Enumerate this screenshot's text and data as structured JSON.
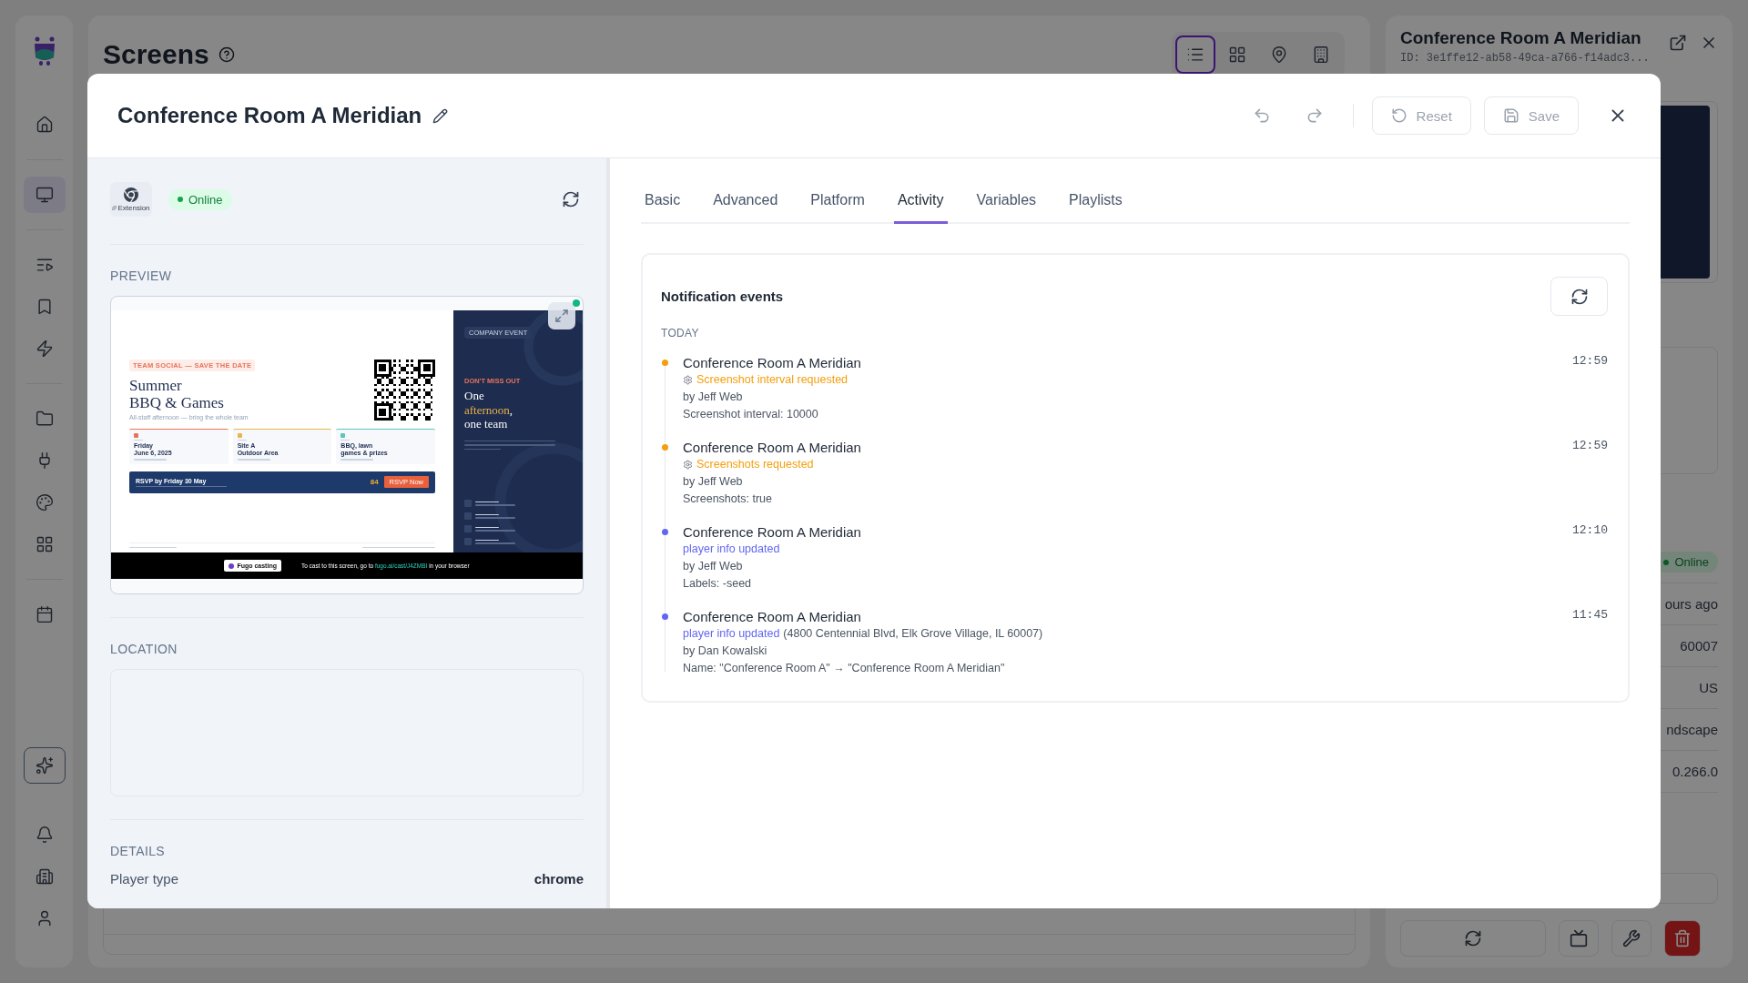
{
  "sidebar": {
    "groups": [
      {
        "items": [
          {
            "kind": "home",
            "selected": false
          }
        ]
      },
      {
        "items": [
          {
            "kind": "screens",
            "selected": true
          }
        ]
      },
      {
        "items": [
          {
            "kind": "playlists",
            "selected": false
          },
          {
            "kind": "bookmarks",
            "selected": false
          },
          {
            "kind": "automations",
            "selected": false
          }
        ]
      },
      {
        "items": [
          {
            "kind": "files",
            "selected": false
          },
          {
            "kind": "integrations",
            "selected": false
          },
          {
            "kind": "themes",
            "selected": false
          },
          {
            "kind": "apps",
            "selected": false
          }
        ]
      },
      {
        "items": [
          {
            "kind": "schedule",
            "selected": false
          }
        ]
      }
    ],
    "bottom_groups": [
      {
        "items": [
          {
            "kind": "assistant",
            "selected": false
          }
        ]
      },
      {
        "items": [
          {
            "kind": "notifications",
            "selected": false
          },
          {
            "kind": "organization",
            "selected": false
          },
          {
            "kind": "account",
            "selected": false
          }
        ]
      }
    ]
  },
  "page": {
    "title": "Screens",
    "views": [
      {
        "kind": "list",
        "selected": true
      },
      {
        "kind": "grid",
        "selected": false
      },
      {
        "kind": "map",
        "selected": false
      },
      {
        "kind": "building",
        "selected": false
      }
    ]
  },
  "detail_panel": {
    "title": "Conference Room A Meridian",
    "id": "ID: 3e1ffe12-ab58-49ca-a766-f14adc3...",
    "status": "Online",
    "rows": [
      {
        "value": "ours ago"
      },
      {
        "value": "60007"
      },
      {
        "value": "US"
      },
      {
        "value": "ndscape"
      },
      {
        "value": "0.266.0"
      }
    ]
  },
  "dialog": {
    "title": "Conference Room A Meridian",
    "history": [
      {
        "kind": "undo",
        "disabled": true
      },
      {
        "kind": "redo",
        "disabled": true
      }
    ],
    "actions": [
      {
        "kind": "reset",
        "label": "Reset",
        "disabled": true
      },
      {
        "kind": "save",
        "label": "Save",
        "disabled": true
      }
    ],
    "player": {
      "badge": "Extension",
      "status": "Online",
      "online": true
    },
    "preview": {
      "label": "PREVIEW",
      "live": true,
      "screenshot": {
        "tag": "TEAM SOCIAL — SAVE THE DATE",
        "title_lines": [
          "Summer",
          "BBQ & Games"
        ],
        "subtitle": "All-staff afternoon — bring the whole team",
        "cards": [
          {
            "value_lines": [
              "Friday",
              "June 6, 2025"
            ],
            "color": "#e8735a"
          },
          {
            "value_lines": [
              "Site A",
              "Outdoor Area"
            ],
            "color": "#e8b64a"
          },
          {
            "value_lines": [
              "BBQ, lawn",
              "games & prizes"
            ],
            "color": "#5ac8b8"
          }
        ],
        "rsvp": {
          "title": "RSVP by Friday 30 May",
          "count": "84",
          "button": "RSVP Now"
        },
        "side_tag": "COMPANY EVENT",
        "kicker": "DON'T MISS OUT",
        "headline": [
          [
            {
              "text": "One",
              "accent": false
            }
          ],
          [
            {
              "text": "afternoon",
              "accent": true
            },
            {
              "text": ",",
              "accent": false
            }
          ],
          [
            {
              "text": "one team",
              "accent": false
            }
          ]
        ],
        "cast": {
          "chip": "Fugo casting",
          "before": "To cast to this screen, go to",
          "link": "fugo.ai/cast/J4ZMBI",
          "after": "in your browser"
        }
      }
    },
    "location": {
      "label": "LOCATION"
    },
    "details": {
      "label": "DETAILS",
      "rows": [
        {
          "label": "Player type",
          "value": "chrome"
        }
      ]
    },
    "tabs": [
      {
        "label": "Basic",
        "selected": false
      },
      {
        "label": "Advanced",
        "selected": false
      },
      {
        "label": "Platform",
        "selected": false
      },
      {
        "label": "Activity",
        "selected": true
      },
      {
        "label": "Variables",
        "selected": false
      },
      {
        "label": "Playlists",
        "selected": false
      }
    ],
    "notifications": {
      "title": "Notification events",
      "group": "TODAY",
      "events": [
        {
          "kind": "system",
          "title": "Conference Room A Meridian",
          "action": "Screenshot interval requested",
          "by": "by Jeff Web",
          "detail": "Screenshot interval: 10000",
          "time": "12:59",
          "color": "#f59e0b"
        },
        {
          "kind": "system",
          "title": "Conference Room A Meridian",
          "action": "Screenshots requested",
          "by": "by Jeff Web",
          "detail": "Screenshots: true",
          "time": "12:59",
          "color": "#f59e0b"
        },
        {
          "kind": "user",
          "title": "Conference Room A Meridian",
          "action": "player info updated",
          "by": "by Jeff Web",
          "detail": "Labels: -seed",
          "time": "12:10",
          "color": "#6366f1"
        },
        {
          "kind": "user",
          "title": "Conference Room A Meridian",
          "action": "player info updated",
          "extra": "(4800 Centennial Blvd, Elk Grove Village, IL 60007)",
          "by": "by Dan Kowalski",
          "detail": "Name: \"Conference Room A\" → \"Conference Room A Meridian\"",
          "time": "11:45",
          "color": "#6366f1"
        }
      ]
    }
  }
}
